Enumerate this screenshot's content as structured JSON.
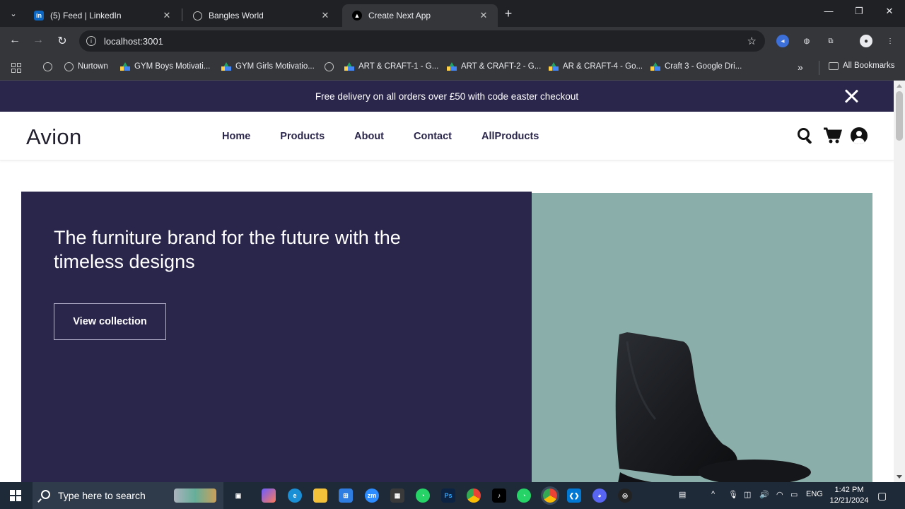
{
  "browser": {
    "tabs": [
      {
        "title": "(5) Feed | LinkedIn",
        "icon": "linkedin-icon",
        "active": false
      },
      {
        "title": "Bangles World",
        "icon": "globe-icon",
        "active": false
      },
      {
        "title": "Create Next App",
        "icon": "nextjs-icon",
        "active": true
      }
    ],
    "url": "localhost:3001",
    "bookmarks": [
      {
        "label": "Nurtown",
        "icon": "globe-icon"
      },
      {
        "label": "GYM Boys Motivati...",
        "icon": "google-drive-icon"
      },
      {
        "label": "GYM Girls Motivatio...",
        "icon": "google-drive-icon"
      },
      {
        "label": "",
        "icon": "globe-icon"
      },
      {
        "label": "ART & CRAFT-1 - G...",
        "icon": "google-drive-icon"
      },
      {
        "label": "ART & CRAFT-2 - G...",
        "icon": "google-drive-icon"
      },
      {
        "label": "AR & CRAFT-4 - Go...",
        "icon": "google-drive-icon"
      },
      {
        "label": "Craft 3 - Google Dri...",
        "icon": "google-drive-icon"
      }
    ],
    "all_bookmarks": "All Bookmarks",
    "overflow": "»"
  },
  "page": {
    "promo_text": "Free delivery on all orders over £50 with code easter checkout",
    "logo": "Avion",
    "nav": [
      "Home",
      "Products",
      "About",
      "Contact",
      "AllProducts"
    ],
    "hero": {
      "title": "The furniture brand for the future with the timeless designs",
      "button": "View collection"
    },
    "colors": {
      "brand_dark": "#2a254b",
      "hero_image_bg": "#8aaeaa",
      "white": "#ffffff"
    }
  },
  "taskbar": {
    "search_placeholder": "Type here to search",
    "language": "ENG",
    "time": "1:42 PM",
    "date": "12/21/2024"
  }
}
